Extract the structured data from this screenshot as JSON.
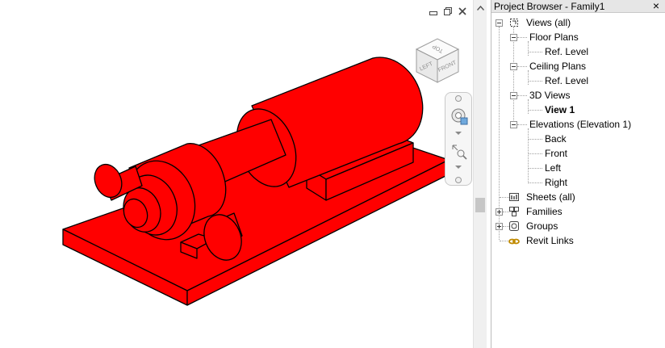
{
  "browser": {
    "title": "Project Browser - Family1",
    "close_label": "×",
    "tree": [
      {
        "id": "views-all",
        "label": "Views (all)",
        "icon": "views-icon"
      },
      {
        "id": "floor-plans",
        "label": "Floor Plans"
      },
      {
        "id": "floor-ref-level",
        "label": "Ref. Level"
      },
      {
        "id": "ceiling-plans",
        "label": "Ceiling Plans"
      },
      {
        "id": "ceiling-ref-level",
        "label": "Ref. Level"
      },
      {
        "id": "3d-views",
        "label": "3D Views"
      },
      {
        "id": "view-1",
        "label": "View 1"
      },
      {
        "id": "elevations",
        "label": "Elevations (Elevation 1)"
      },
      {
        "id": "elev-back",
        "label": "Back"
      },
      {
        "id": "elev-front",
        "label": "Front"
      },
      {
        "id": "elev-left",
        "label": "Left"
      },
      {
        "id": "elev-right",
        "label": "Right"
      },
      {
        "id": "sheets-all",
        "label": "Sheets (all)",
        "icon": "sheets-icon"
      },
      {
        "id": "families",
        "label": "Families",
        "icon": "families-icon"
      },
      {
        "id": "groups",
        "label": "Groups",
        "icon": "groups-icon"
      },
      {
        "id": "revit-links",
        "label": "Revit Links",
        "icon": "revit-links-icon"
      }
    ]
  },
  "viewcube": {
    "top": "TOP",
    "left": "LEFT",
    "front": "FRONT"
  },
  "colors": {
    "model_fill": "#ff0000",
    "model_edge": "#000000",
    "tree_line": "#a0a0a0"
  }
}
